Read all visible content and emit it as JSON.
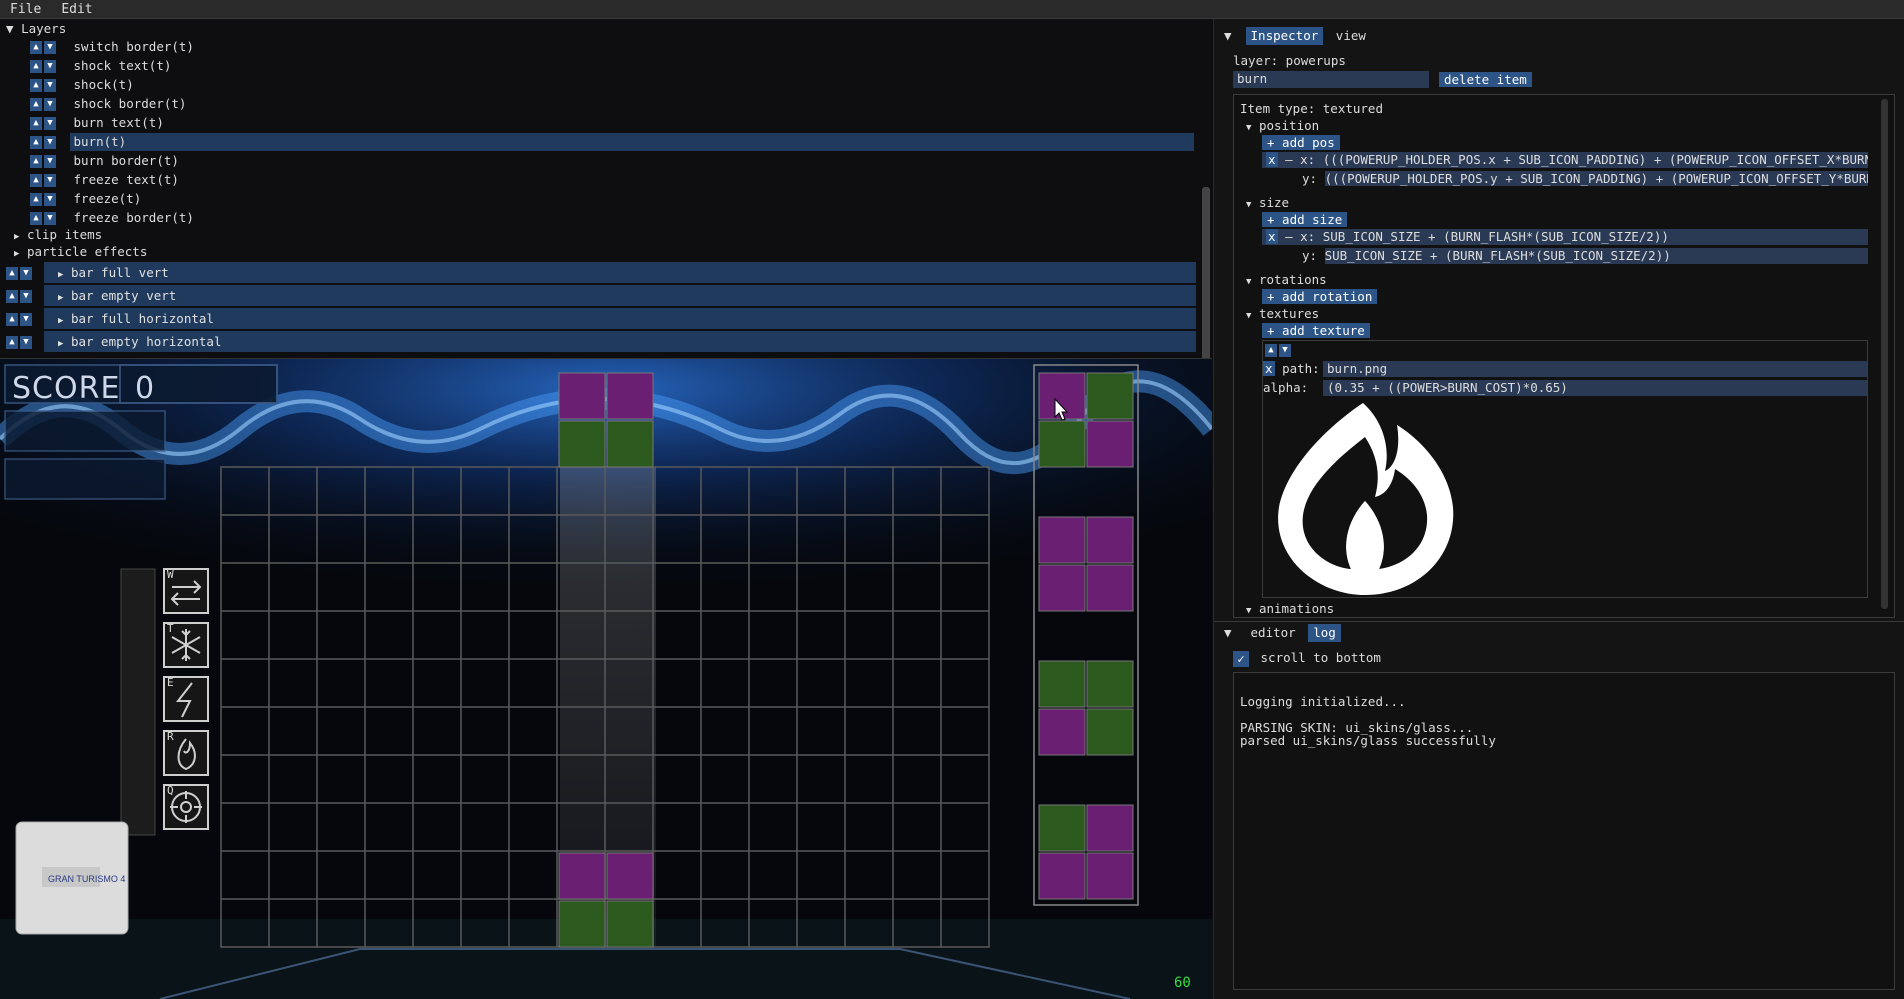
{
  "menu": [
    "File",
    "Edit"
  ],
  "layers": {
    "header": "Layers",
    "items": [
      "switch border(t)",
      "shock text(t)",
      "shock(t)",
      "shock border(t)",
      "burn text(t)",
      "burn(t)",
      "burn border(t)",
      "freeze text(t)",
      "freeze(t)",
      "freeze border(t)"
    ],
    "groups": [
      "clip items",
      "particle effects"
    ],
    "bars": [
      "bar full vert",
      "bar empty vert",
      "bar full horizontal",
      "bar empty horizontal"
    ]
  },
  "game": {
    "score_label": "SCORE",
    "score_value": "0",
    "power_keys": [
      "W",
      "T",
      "E",
      "R",
      "Q"
    ],
    "fps": "60",
    "colors": {
      "purple": "#6a1f73",
      "green": "#2c5a1e"
    }
  },
  "inspector": {
    "tabs": [
      "Inspector",
      "view"
    ],
    "layer": "layer: powerups",
    "item_name": "burn",
    "delete_label": "delete item",
    "item_type": "Item type: textured",
    "position": {
      "label": "position",
      "add": "+ add pos",
      "x": "(((POWERUP_HOLDER_POS.x + SUB_ICON_PADDING) + (POWERUP_ICON_OFFSET_X*BURN_IND))",
      "y": "(((POWERUP_HOLDER_POS.y + SUB_ICON_PADDING) + (POWERUP_ICON_OFFSET_Y*BURN_IND))"
    },
    "size": {
      "label": "size",
      "add": "+ add size",
      "x": "SUB_ICON_SIZE + (BURN_FLASH*(SUB_ICON_SIZE/2))",
      "y": "SUB_ICON_SIZE + (BURN_FLASH*(SUB_ICON_SIZE/2))"
    },
    "rotations": {
      "label": "rotations",
      "add": "+ add rotation"
    },
    "textures": {
      "label": "textures",
      "add": "+ add texture",
      "path_label": "path:",
      "path": "burn.png",
      "alpha_label": "alpha:",
      "alpha": "(0.35 + ((POWER>BURN_COST)*0.65)"
    },
    "animations": "animations"
  },
  "log": {
    "tabs": [
      "editor",
      "log"
    ],
    "scroll_label": "scroll to bottom",
    "lines": [
      "Logging initialized...",
      "",
      "PARSING SKIN: ui_skins/glass...",
      "parsed ui_skins/glass successfully"
    ]
  }
}
